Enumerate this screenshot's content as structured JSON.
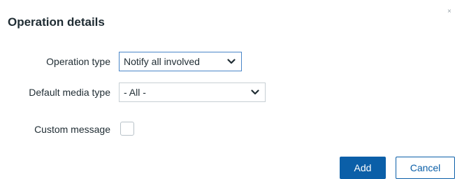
{
  "dialog": {
    "title": "Operation details",
    "close_glyph": "×"
  },
  "form": {
    "operation_type": {
      "label": "Operation type",
      "value": "Notify all involved"
    },
    "default_media_type": {
      "label": "Default media type",
      "value": "- All -"
    },
    "custom_message": {
      "label": "Custom message",
      "checked": false
    }
  },
  "footer": {
    "add_label": "Add",
    "cancel_label": "Cancel"
  },
  "colors": {
    "primary": "#0b5fa8",
    "focus_border": "#4a86c8",
    "text": "#1f2c33"
  },
  "icons": {
    "select_arrow": "chevron-down-icon",
    "close": "close-icon"
  }
}
